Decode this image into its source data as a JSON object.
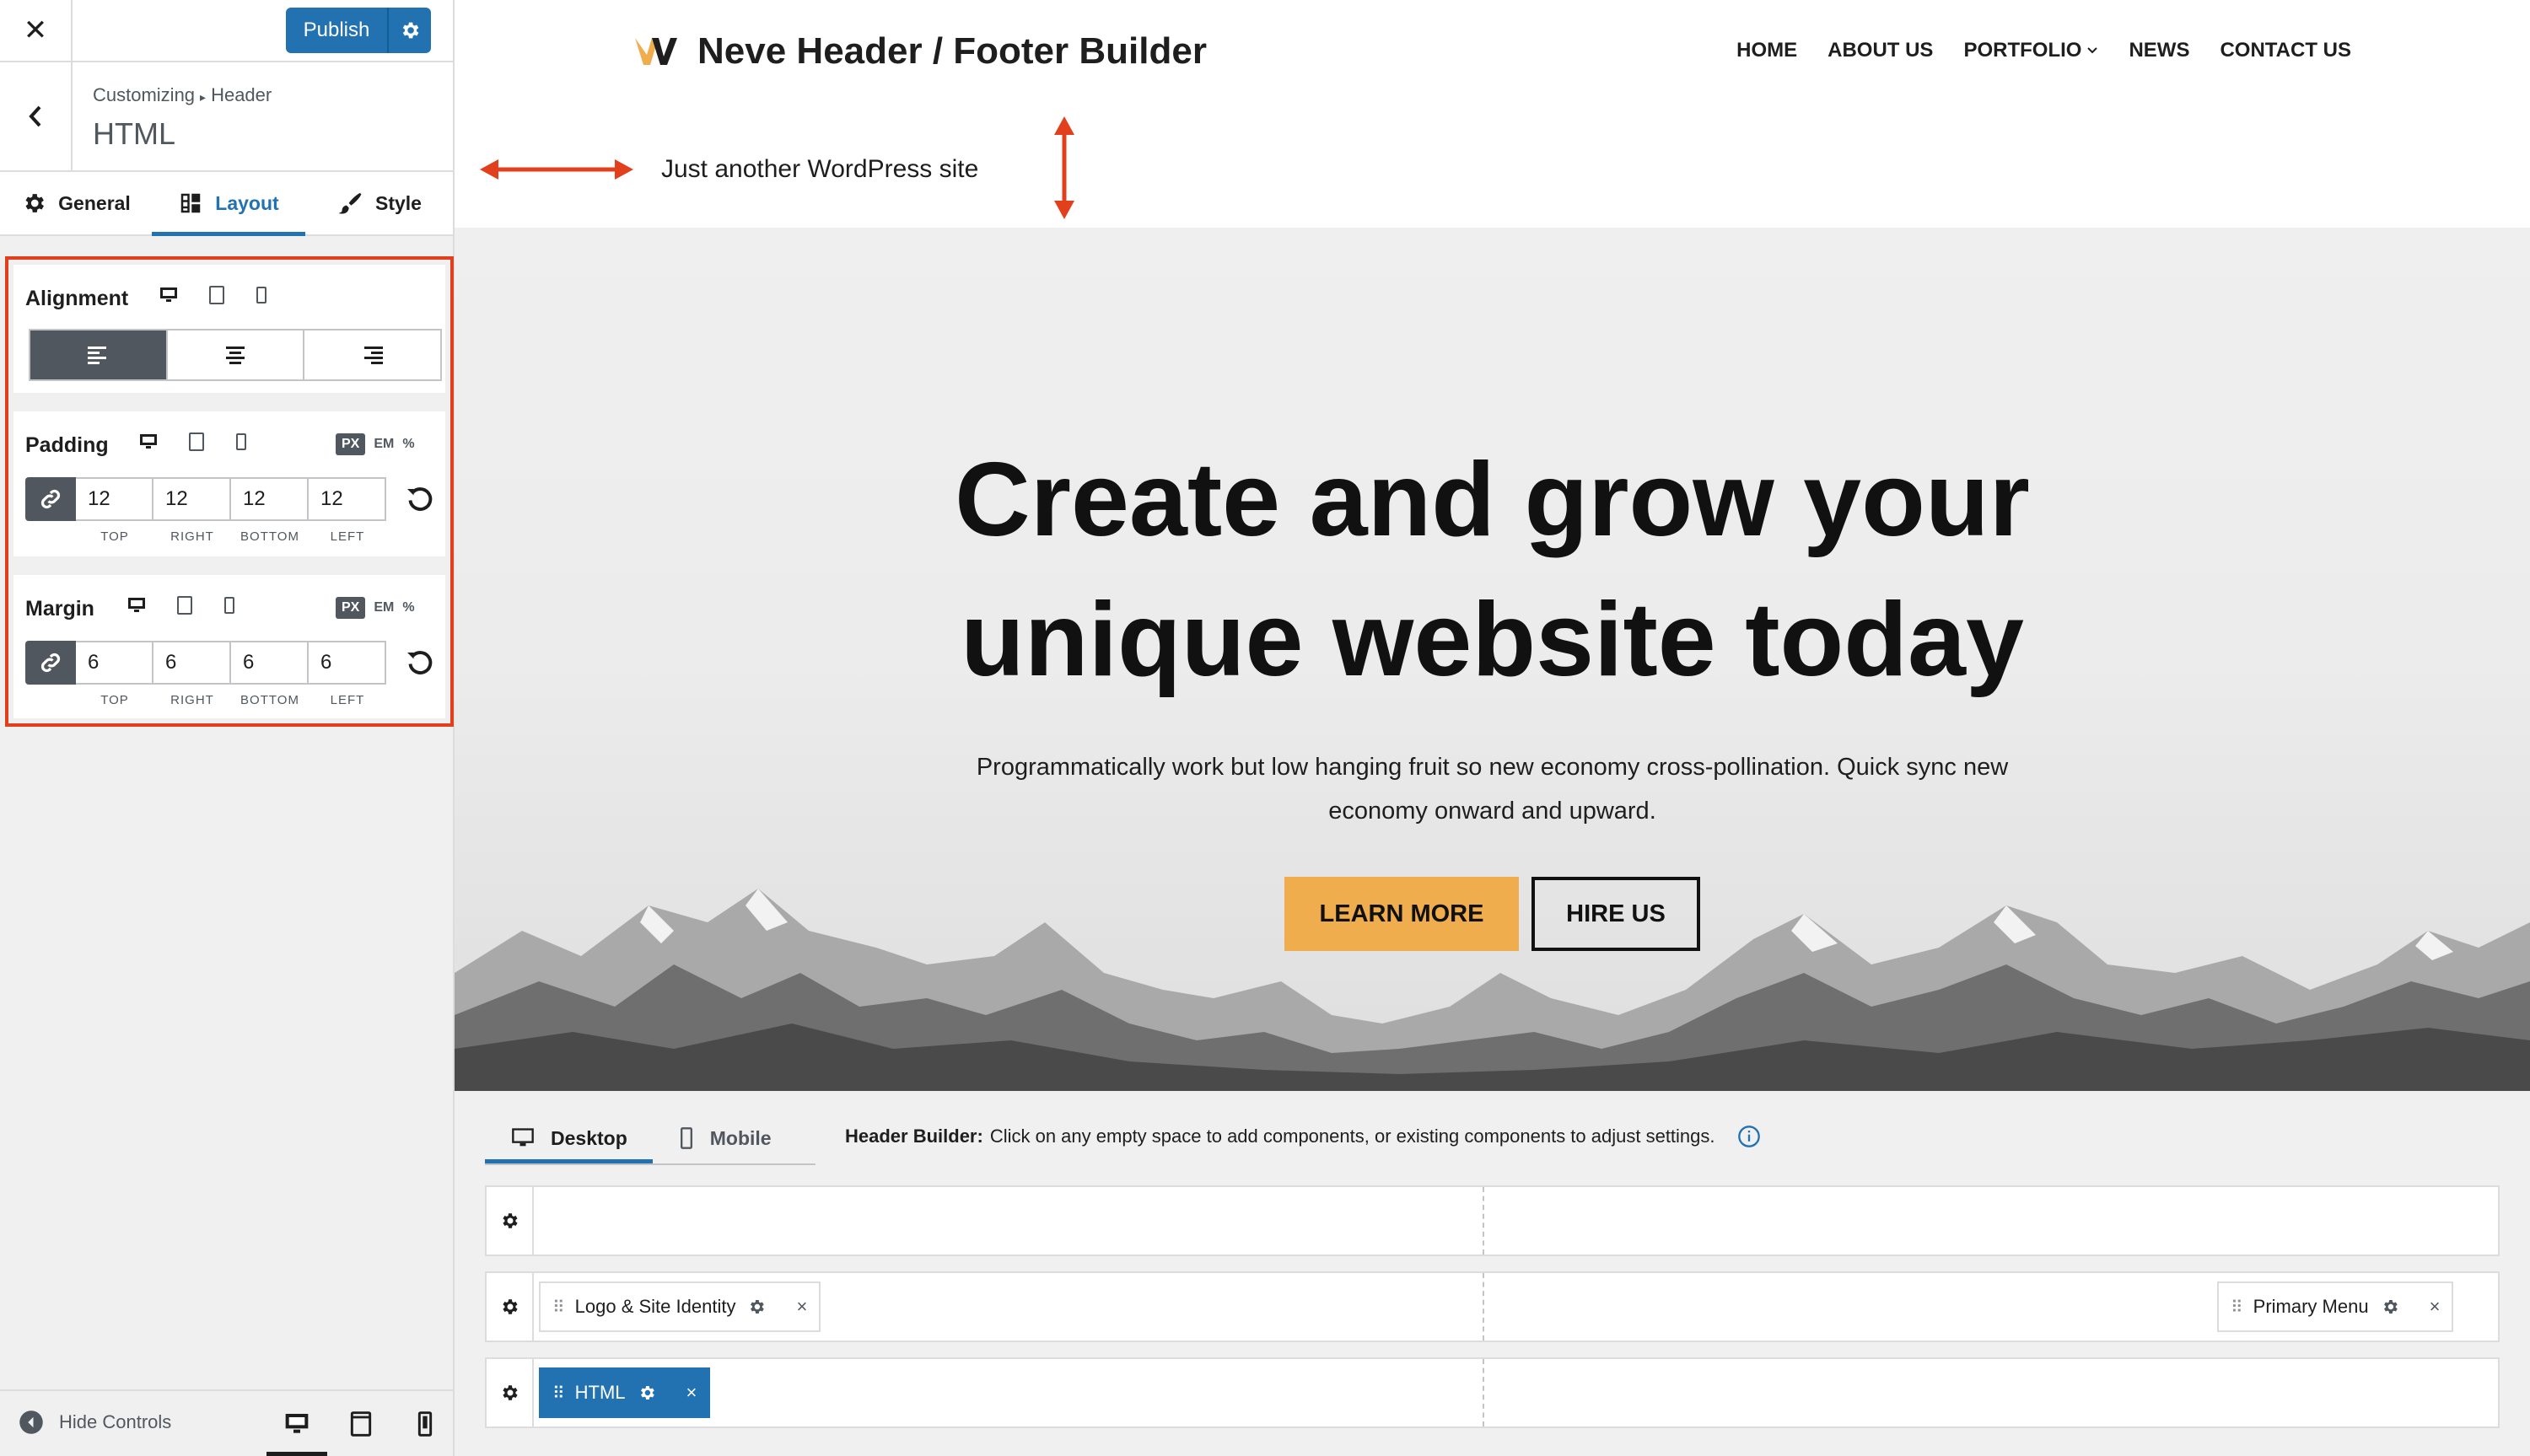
{
  "sidebar": {
    "publish_label": "Publish",
    "breadcrumb": {
      "root": "Customizing",
      "parent": "Header"
    },
    "section_title": "HTML",
    "tabs": [
      {
        "label": "General",
        "icon": "gear-icon",
        "active": false
      },
      {
        "label": "Layout",
        "icon": "layout-icon",
        "active": true
      },
      {
        "label": "Style",
        "icon": "brush-icon",
        "active": false
      }
    ],
    "alignment": {
      "label": "Alignment",
      "options": [
        "left",
        "center",
        "right"
      ],
      "selected": "left"
    },
    "padding": {
      "label": "Padding",
      "units": [
        "PX",
        "EM",
        "%"
      ],
      "selected_unit": "PX",
      "linked": true,
      "values": {
        "top": "12",
        "right": "12",
        "bottom": "12",
        "left": "12"
      },
      "side_labels": [
        "TOP",
        "RIGHT",
        "BOTTOM",
        "LEFT"
      ]
    },
    "margin": {
      "label": "Margin",
      "units": [
        "PX",
        "EM",
        "%"
      ],
      "selected_unit": "PX",
      "linked": true,
      "values": {
        "top": "6",
        "right": "6",
        "bottom": "6",
        "left": "6"
      },
      "side_labels": [
        "TOP",
        "RIGHT",
        "BOTTOM",
        "LEFT"
      ]
    },
    "hide_controls_label": "Hide Controls",
    "preview_device": "desktop"
  },
  "site": {
    "title": "Neve Header / Footer Builder",
    "tagline": "Just another WordPress site",
    "nav": [
      "HOME",
      "ABOUT US",
      "PORTFOLIO",
      "NEWS",
      "CONTACT US"
    ],
    "hero": {
      "title_line1": "Create and grow your",
      "title_line2": "unique website today",
      "text": "Programmatically work but low hanging fruit so new economy cross-pollination. Quick sync new economy onward and upward.",
      "primary_button": "LEARN MORE",
      "secondary_button": "HIRE US"
    }
  },
  "builder": {
    "tabs": [
      {
        "label": "Desktop",
        "active": true
      },
      {
        "label": "Mobile",
        "active": false
      }
    ],
    "info_title": "Header Builder:",
    "info_text": "Click on any empty space to add components, or existing components to adjust settings.",
    "rows": [
      {
        "components": []
      },
      {
        "components": [
          "Logo & Site Identity",
          "Primary Menu"
        ]
      },
      {
        "components": [
          "HTML"
        ]
      }
    ],
    "selected_component": "HTML"
  },
  "colors": {
    "accent": "#2271b1",
    "highlight_border": "#e2401c",
    "learn_more_bg": "#f0ad4e",
    "logo_orange": "#f0ad4e"
  }
}
